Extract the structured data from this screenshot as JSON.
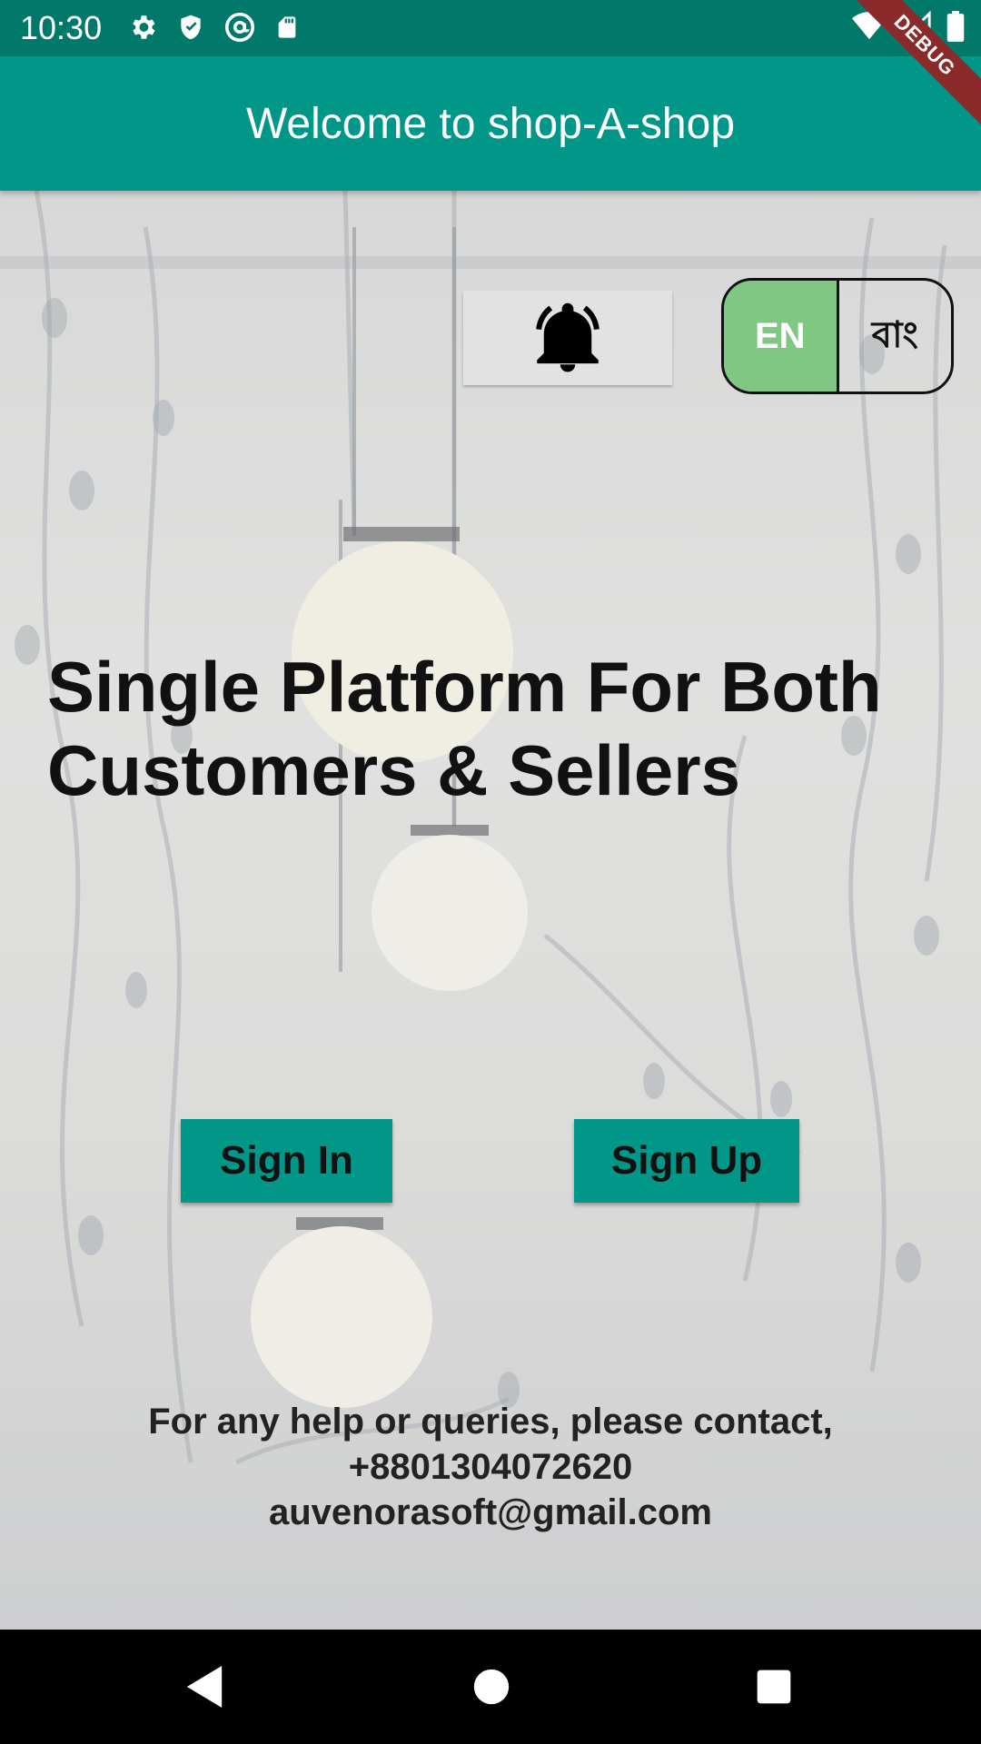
{
  "status_bar": {
    "time": "10:30",
    "left_icons": [
      "gear-icon",
      "shield-icon",
      "at-sign-icon",
      "sd-card-icon"
    ],
    "right_icons": [
      "wifi-icon",
      "signal-icon",
      "battery-icon"
    ],
    "debug_label": "DEBUG"
  },
  "app_bar": {
    "title": "Welcome to shop-A-shop"
  },
  "notification": {
    "icon": "bell-icon"
  },
  "language_toggle": {
    "selected": "EN",
    "options": [
      "EN",
      "বাং"
    ]
  },
  "hero": {
    "line1": "Single Platform For Both",
    "line2": "Customers & Sellers"
  },
  "actions": {
    "sign_in": "Sign In",
    "sign_up": "Sign Up"
  },
  "contact": {
    "line1": "For any help or queries, please contact,",
    "phone": "+8801304072620",
    "email": "auvenorasoft@gmail.com"
  },
  "nav_bar": {
    "buttons": [
      "back-icon",
      "home-icon",
      "recents-icon"
    ]
  },
  "colors": {
    "status_bar": "#00796b",
    "app_bar": "#009688",
    "button": "#009688",
    "lang_selected": "#81c784"
  }
}
